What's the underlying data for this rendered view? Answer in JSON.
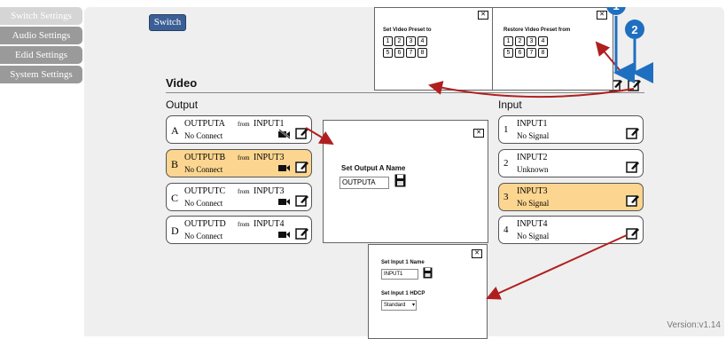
{
  "sidebar": {
    "items": [
      {
        "label": "Switch Settings",
        "active": true
      },
      {
        "label": "Audio Settings",
        "active": false
      },
      {
        "label": "Edid Settings",
        "active": false
      },
      {
        "label": "System Settings",
        "active": false
      }
    ]
  },
  "tab": {
    "label": "Switch"
  },
  "video": {
    "title": "Video",
    "output_label": "Output",
    "input_label": "Input"
  },
  "outputs": [
    {
      "letter": "A",
      "name": "OUTPUTA",
      "from": "from",
      "input": "INPUT1",
      "status": "No Connect",
      "highlighted": false
    },
    {
      "letter": "B",
      "name": "OUTPUTB",
      "from": "from",
      "input": "INPUT3",
      "status": "No Connect",
      "highlighted": true
    },
    {
      "letter": "C",
      "name": "OUTPUTC",
      "from": "from",
      "input": "INPUT3",
      "status": "No Connect",
      "highlighted": false
    },
    {
      "letter": "D",
      "name": "OUTPUTD",
      "from": "from",
      "input": "INPUT4",
      "status": "No Connect",
      "highlighted": false
    }
  ],
  "inputs": [
    {
      "num": "1",
      "name": "INPUT1",
      "status": "No Signal",
      "highlighted": false
    },
    {
      "num": "2",
      "name": "INPUT2",
      "status": "Unknown",
      "highlighted": false
    },
    {
      "num": "3",
      "name": "INPUT3",
      "status": "No Signal",
      "highlighted": true
    },
    {
      "num": "4",
      "name": "INPUT4",
      "status": "No Signal",
      "highlighted": false
    }
  ],
  "preset_set": {
    "title": "Set Video Preset to",
    "keys": [
      "1",
      "2",
      "3",
      "4",
      "5",
      "6",
      "7",
      "8"
    ]
  },
  "preset_restore": {
    "title": "Restore Video Preset from",
    "keys": [
      "1",
      "2",
      "3",
      "4",
      "5",
      "6",
      "7",
      "8"
    ]
  },
  "output_name_popup": {
    "title": "Set Output A Name",
    "value": "OUTPUTA"
  },
  "input_popup": {
    "name_title": "Set Input 1 Name",
    "name_value": "INPUT1",
    "hdcp_title": "Set Input 1 HDCP",
    "hdcp_value": "Standard"
  },
  "callouts": {
    "one": "1",
    "two": "2"
  },
  "version": "Version:v1.14",
  "colors": {
    "accent": "#3b5f95",
    "highlight": "#fcd690",
    "arrow": "#b01f1f",
    "callout": "#1f6fc0"
  }
}
